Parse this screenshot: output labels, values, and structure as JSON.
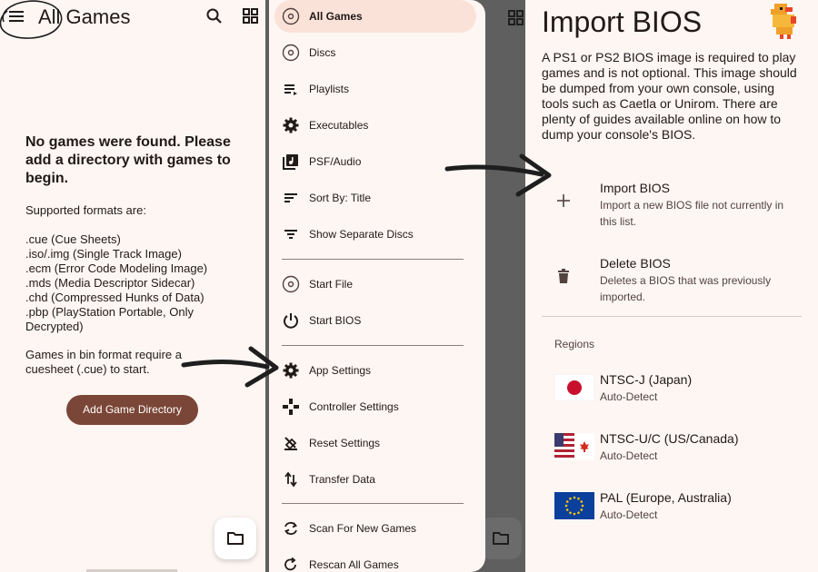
{
  "game_list": {
    "title": "All Games",
    "empty_message": "No games were found. Please add a directory with games to begin.",
    "formats_label": "Supported formats are:",
    "formats": [
      ".cue (Cue Sheets)",
      ".iso/.img (Single Track Image)",
      ".ecm (Error Code Modeling Image)",
      ".mds (Media Descriptor Sidecar)",
      ".chd (Compressed Hunks of Data)",
      ".pbp (PlayStation Portable, Only Decrypted)"
    ],
    "bin_note": "Games in bin format require a cuesheet (.cue) to start.",
    "add_button": "Add Game Directory",
    "icons": {
      "menu": "hamburger-menu-icon",
      "search": "search-icon",
      "grid": "grid-view-icon",
      "fab": "folder-icon"
    }
  },
  "drawer": {
    "items": [
      {
        "label": "All Games",
        "icon": "disc-icon",
        "active": true
      },
      {
        "label": "Discs",
        "icon": "disc-icon"
      },
      {
        "label": "Playlists",
        "icon": "playlist-icon"
      },
      {
        "label": "Executables",
        "icon": "gear-icon"
      },
      {
        "label": "PSF/Audio",
        "icon": "music-library-icon"
      },
      {
        "label": "Sort By: Title",
        "icon": "sort-icon"
      },
      {
        "label": "Show Separate Discs",
        "icon": "filter-icon"
      },
      {
        "label": "Start File",
        "icon": "disc-icon"
      },
      {
        "label": "Start BIOS",
        "icon": "power-icon"
      },
      {
        "label": "App Settings",
        "icon": "gear-icon"
      },
      {
        "label": "Controller Settings",
        "icon": "gamepad-icon"
      },
      {
        "label": "Reset Settings",
        "icon": "reset-icon"
      },
      {
        "label": "Transfer Data",
        "icon": "transfer-icon"
      },
      {
        "label": "Scan For New Games",
        "icon": "sync-icon"
      },
      {
        "label": "Rescan All Games",
        "icon": "refresh-icon"
      }
    ]
  },
  "bios": {
    "title": "Import BIOS",
    "description": "A PS1 or PS2 BIOS image is required to play games and is not optional. This image should be dumped from your own console, using tools such as Caetla or Unirom. There are plenty of guides available online on how to dump your console's BIOS.",
    "import": {
      "title": "Import BIOS",
      "subtitle": "Import a new BIOS file not currently in this list."
    },
    "delete": {
      "title": "Delete BIOS",
      "subtitle": "Deletes a BIOS that was previously imported."
    },
    "regions_label": "Regions",
    "regions": [
      {
        "title": "NTSC-J (Japan)",
        "subtitle": "Auto-Detect",
        "flag": "japan-flag"
      },
      {
        "title": "NTSC-U/C (US/Canada)",
        "subtitle": "Auto-Detect",
        "flag": "us-canada-flag"
      },
      {
        "title": "PAL (Europe, Australia)",
        "subtitle": "Auto-Detect",
        "flag": "eu-flag"
      }
    ]
  },
  "colors": {
    "background": "#fdf6f3",
    "accent": "#7a4637",
    "drawer_active": "#fbe2d8",
    "scrim": "#5f5f5f",
    "annotation": "#1e1e1e"
  }
}
